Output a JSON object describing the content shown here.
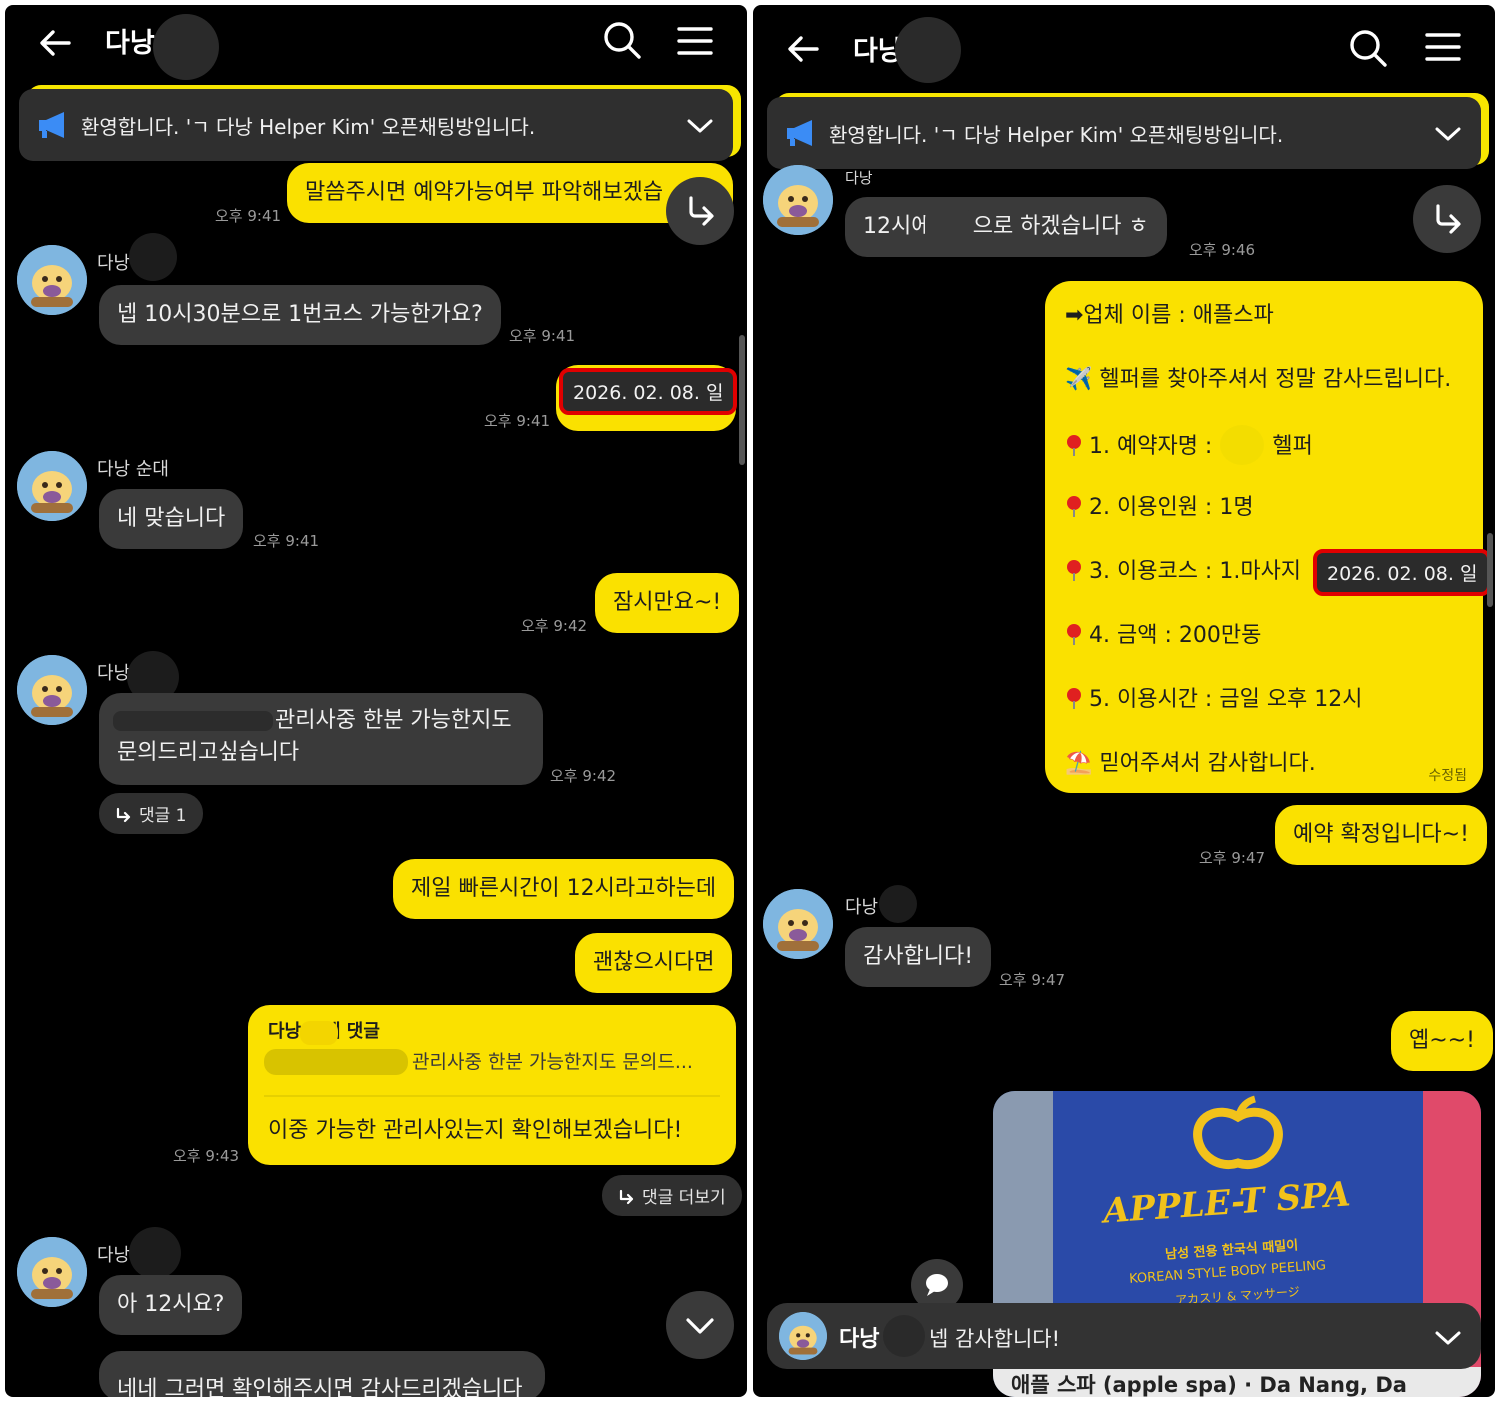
{
  "left": {
    "header": {
      "title": "다낭"
    },
    "notice": {
      "text": "환영합니다. 'ㄱ 다낭 Helper Kim' 오픈채팅방입니다."
    },
    "messages": {
      "m1": {
        "text": "말씀주시면 예약가능여부 파악해보겠습",
        "time": "오후 9:41"
      },
      "m2": {
        "sender": "다낭",
        "text": "넵 10시30분으로 1번코스 가능한가요?",
        "time": "오후 9:41"
      },
      "m3": {
        "date": "2026. 02. 08. 일",
        "time": "오후 9:41"
      },
      "m4": {
        "sender": "다낭 순대",
        "text": "네 맞습니다",
        "time": "오후 9:41"
      },
      "m5": {
        "text": "잠시만요~!",
        "time": "오후 9:42"
      },
      "m6": {
        "sender": "다낭",
        "line1": "관리사중 한분 가능한지도",
        "line2": "문의드리고싶습니다",
        "time": "오후 9:42",
        "replies": "댓글 1"
      },
      "m7": {
        "text": "제일 빠른시간이 12시라고하는데"
      },
      "m8": {
        "text": "괜찮으시다면"
      },
      "m9": {
        "reply_to": "다낭 에게 댓글",
        "quote": "관리사중 한분 가능한지도 문의드...",
        "text": "이중 가능한 관리사있는지 확인해보겠습니다!",
        "time": "오후 9:43",
        "more": "댓글 더보기"
      },
      "m10": {
        "sender": "다낭",
        "text": "아 12시요?",
        "partial": "네네 그러면 확인해주시면 감사드리겠습니다"
      }
    }
  },
  "right": {
    "header": {
      "title": "다낭"
    },
    "notice": {
      "text": "환영합니다. 'ㄱ 다낭 Helper Kim' 오픈채팅방입니다."
    },
    "messages": {
      "r1": {
        "sender": "다낭",
        "text": "12시에 1번으로 하겠습니다 ㅎ",
        "time": "오후 9:46"
      },
      "card": {
        "l1": "➡업체 이름 : 애플스파",
        "l2": "✈️ 헬퍼를 찾아주셔서 정말 감사드립니다.",
        "l3a": "1. 예약자명 :",
        "l3b": "헬퍼",
        "l4": "2. 이용인원 :  1명",
        "l5": "3. 이용코스 :  1.마사지",
        "l6": "4. 금액 : 200만동",
        "l7": "5. 이용시간 : 금일 오후 12시",
        "l8": "⛱️ 믿어주셔서 감사합니다.",
        "edited": "수정됨",
        "date": "2026. 02. 08. 일"
      },
      "r2": {
        "text": "예약 확정입니다~!",
        "time": "오후 9:47"
      },
      "r3": {
        "sender": "다낭",
        "text": "감사합니다!",
        "time": "오후 9:47"
      },
      "r4": {
        "text": "옙~~!"
      },
      "photo": {
        "sign_top": "APPLE-T SPA",
        "sign_kr": "남성 전용 한국식 때밀이",
        "sign_en": "KOREAN STYLE BODY PEELING",
        "sign_jp": "アカスリ & マッサージ",
        "caption": "애플 스파 (apple spa) · Da Nang, Da"
      },
      "banner": {
        "sender": "다낭",
        "text": "넵 감사합니다!"
      }
    }
  }
}
